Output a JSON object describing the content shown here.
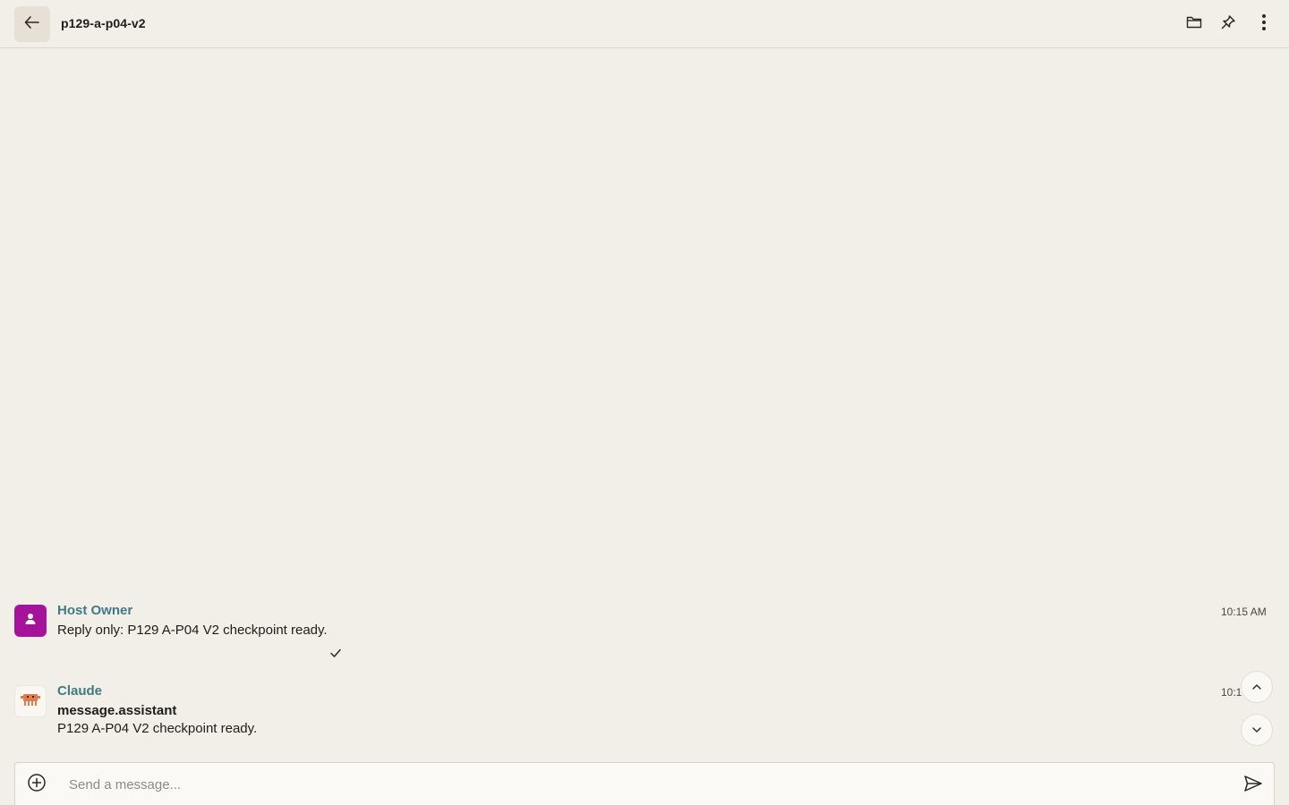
{
  "header": {
    "title": "p129-a-p04-v2",
    "icons": {
      "back": "arrow-left-icon",
      "folder": "folder-icon",
      "pin": "pin-icon",
      "menu": "more-vertical-icon"
    }
  },
  "messages": [
    {
      "sender": "Host Owner",
      "time": "10:15 AM",
      "text": "Reply only: P129 A-P04 V2 checkpoint ready.",
      "avatar_icon": "user-icon",
      "avatar_color": "#a4139a",
      "status_icon": "checkmark-icon"
    },
    {
      "sender": "Claude",
      "time": "10:1",
      "heading": "message.assistant",
      "text": "P129 A-P04 V2 checkpoint ready.",
      "avatar_icon": "robot-crab-icon",
      "avatar_color": "#e07a4f"
    }
  ],
  "composer": {
    "placeholder": "Send a message...",
    "value": "",
    "attach_icon": "plus-circle-icon",
    "send_icon": "send-icon"
  },
  "colors": {
    "background": "#f2eee8",
    "sender_name": "#3f7a86"
  }
}
